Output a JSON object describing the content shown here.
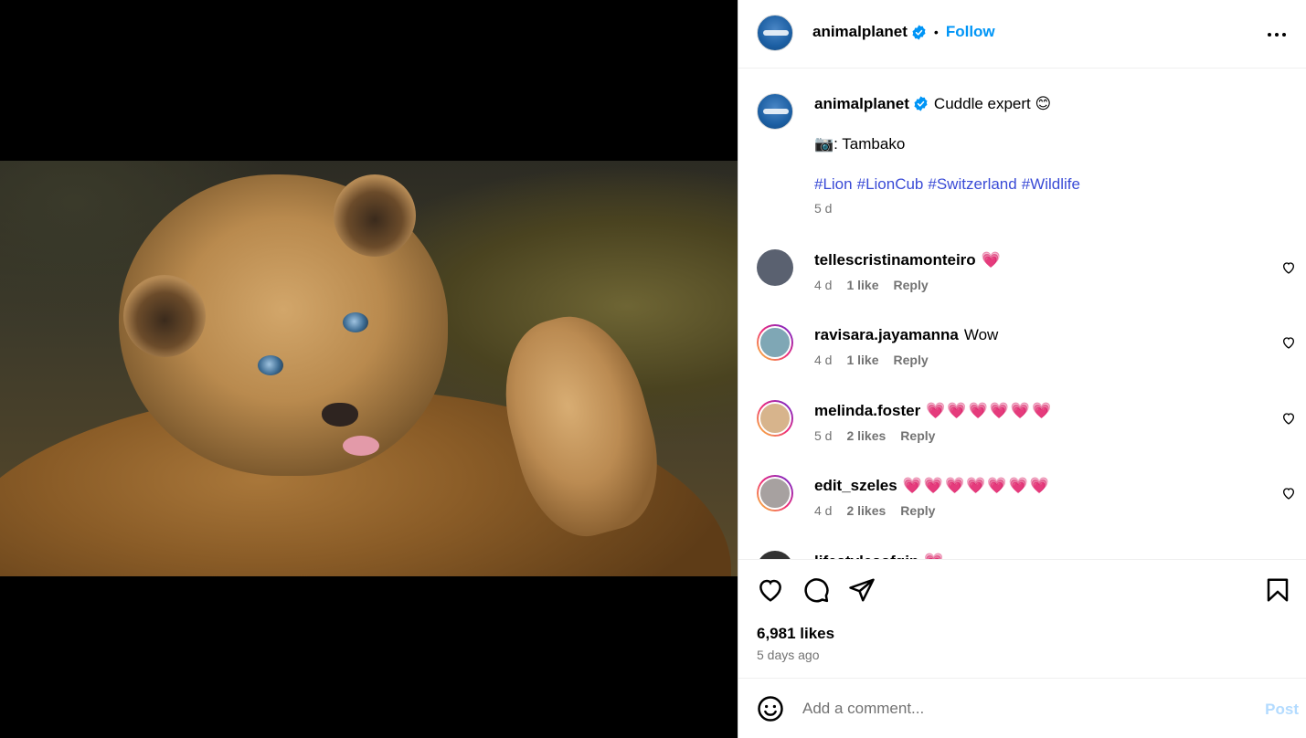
{
  "header": {
    "username": "animalplanet",
    "separator": "•",
    "follow_label": "Follow",
    "more_icon": "more-horizontal-icon"
  },
  "caption": {
    "username": "animalplanet",
    "text": "Cuddle expert 😊",
    "credit": "📷: Tambako",
    "hashtags": [
      "#Lion",
      "#LionCub",
      "#Switzerland",
      "#Wildlife"
    ],
    "age": "5 d"
  },
  "comments": [
    {
      "username": "tellescristinamonteiro",
      "text": "💗",
      "age": "4 d",
      "likes": "1 like",
      "reply": "Reply",
      "avatar_color": "#5a6170"
    },
    {
      "username": "ravisara.jayamanna",
      "text": "Wow",
      "age": "4 d",
      "likes": "1 like",
      "reply": "Reply",
      "avatar_color": "#7fa7b5"
    },
    {
      "username": "melinda.foster",
      "text": "💗💗💗💗💗💗",
      "age": "5 d",
      "likes": "2 likes",
      "reply": "Reply",
      "avatar_color": "#d7b48c"
    },
    {
      "username": "edit_szeles",
      "text": "💗💗💗💗💗💗💗",
      "age": "4 d",
      "likes": "2 likes",
      "reply": "Reply",
      "avatar_color": "#a7a1a0"
    },
    {
      "username": "lifestylesofgin",
      "text": "💗",
      "age": "",
      "likes": "",
      "reply": "",
      "avatar_color": "#333333"
    }
  ],
  "actions": {
    "like_icon": "heart-outline-icon",
    "comment_icon": "comment-bubble-icon",
    "share_icon": "paper-plane-icon",
    "save_icon": "bookmark-icon",
    "likes_count": "6,981 likes",
    "posted_ago": "5 days ago"
  },
  "composer": {
    "placeholder": "Add a comment...",
    "post_label": "Post"
  },
  "colors": {
    "accent": "#0095f6",
    "hashtag": "#3a4bd6",
    "muted": "#737373",
    "post_disabled": "#b3dbff",
    "heart": "#ee2a57"
  }
}
